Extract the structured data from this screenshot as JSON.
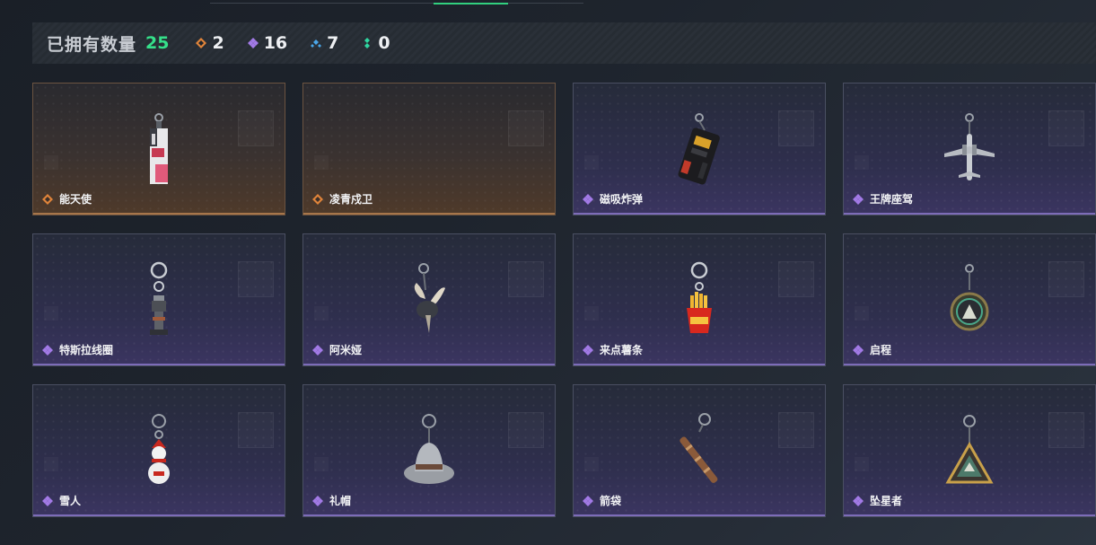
{
  "top": {
    "cut_text": "- -----  -----"
  },
  "stats": {
    "label": "已拥有数量",
    "total": "25",
    "rarities": [
      {
        "icon": "orange-gem-icon",
        "count": "2",
        "color": "#e0843a"
      },
      {
        "icon": "purple-gem-icon",
        "count": "16",
        "color": "#a27ae6"
      },
      {
        "icon": "blue-gem-icon",
        "count": "7",
        "color": "#4aa6e8"
      },
      {
        "icon": "green-gem-icon",
        "count": "0",
        "color": "#2fd6a0"
      }
    ]
  },
  "items": [
    {
      "name": "能天使",
      "rarity": "orange",
      "icon": "angel-charm-icon"
    },
    {
      "name": "凌青戍卫",
      "rarity": "orange",
      "icon": "empty-slot"
    },
    {
      "name": "磁吸炸弹",
      "rarity": "purple",
      "icon": "magnetic-bomb-charm-icon"
    },
    {
      "name": "王牌座驾",
      "rarity": "purple",
      "icon": "jet-plane-charm-icon"
    },
    {
      "name": "特斯拉线圈",
      "rarity": "purple",
      "icon": "tesla-coil-charm-icon"
    },
    {
      "name": "阿米娅",
      "rarity": "purple",
      "icon": "bunny-ears-charm-icon"
    },
    {
      "name": "来点薯条",
      "rarity": "purple",
      "icon": "fries-charm-icon"
    },
    {
      "name": "启程",
      "rarity": "purple",
      "icon": "medal-charm-icon"
    },
    {
      "name": "雪人",
      "rarity": "purple",
      "icon": "snowman-charm-icon"
    },
    {
      "name": "礼帽",
      "rarity": "purple",
      "icon": "hat-charm-icon"
    },
    {
      "name": "箭袋",
      "rarity": "purple",
      "icon": "quiver-charm-icon"
    },
    {
      "name": "坠星者",
      "rarity": "purple",
      "icon": "triangle-badge-charm-icon"
    }
  ],
  "colors": {
    "accent_green": "#35e08a",
    "orange": "#e0843a",
    "purple": "#a27ae6"
  }
}
